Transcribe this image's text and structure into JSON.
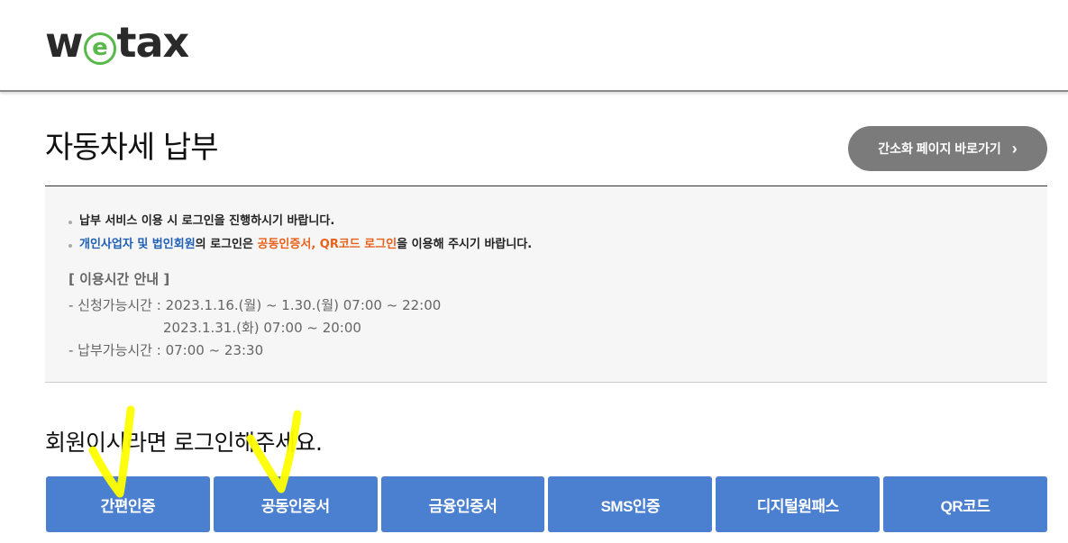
{
  "header": {
    "logo_left": "w",
    "logo_e": "e",
    "logo_right": "tax"
  },
  "page": {
    "title": "자동차세 납부",
    "simple_page_button": "간소화 페이지 바로가기",
    "chevron_glyph": "›"
  },
  "notice": {
    "bullet1": "납부 서비스 이용 시 로그인을 진행하시기 바랍니다.",
    "bullet2": {
      "part1": "개인사업자 및 법인회원",
      "part2": "의 로그인은 ",
      "part3": "공동인증서, QR코드 로그인",
      "part4": "을 이용해 주시기 바랍니다."
    },
    "hours_title": "[ 이용시간 안내 ]",
    "apply_label": "- 신청가능시간 : ",
    "apply_time1": "2023.1.16.(월) ~ 1.30.(월) 07:00 ~ 22:00",
    "apply_time2": "2023.1.31.(화) 07:00 ~ 20:00",
    "pay_label": "- 납부가능시간 : ",
    "pay_time": "07:00 ~ 23:30"
  },
  "login": {
    "prompt": "회원이시라면 로그인해주세요.",
    "methods": [
      "간편인증",
      "공동인증서",
      "금융인증서",
      "SMS인증",
      "디지털원패스",
      "QR코드"
    ]
  },
  "colors": {
    "accent_blue": "#4b7fcf",
    "link_blue": "#1f5fb8",
    "highlight_orange": "#e8611a",
    "logo_green": "#59b84a",
    "annotation_yellow": "#ffff00"
  }
}
